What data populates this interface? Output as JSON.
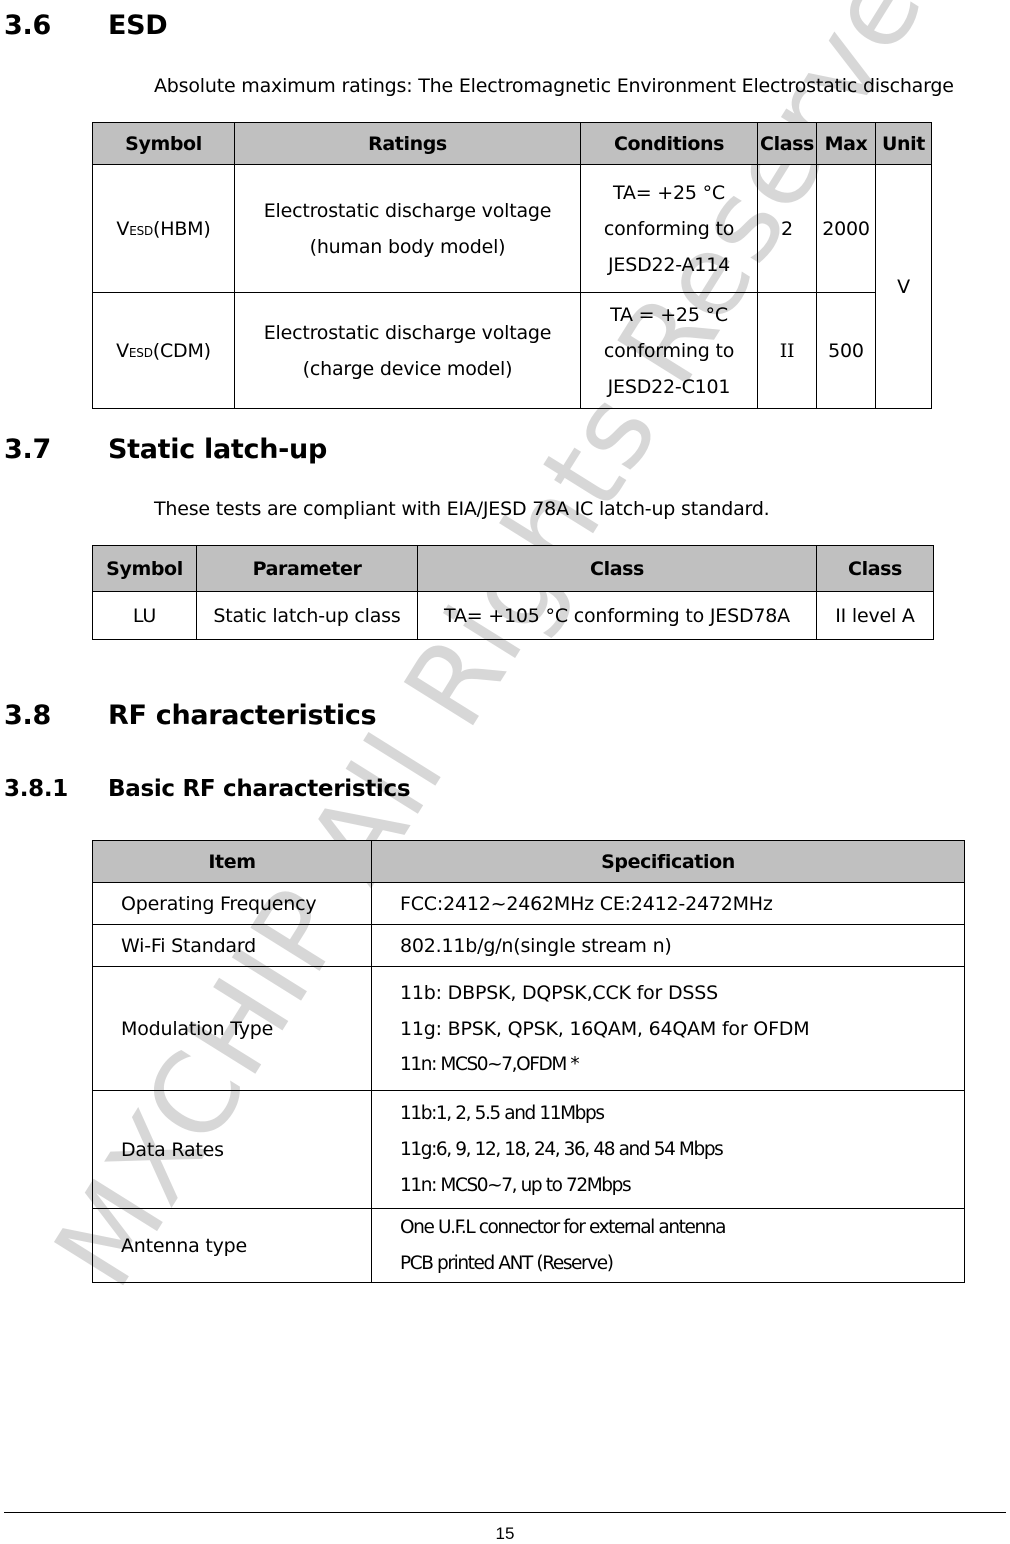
{
  "sections": {
    "esd": {
      "number": "3.6",
      "title": "ESD",
      "intro": "Absolute maximum ratings: The Electromagnetic Environment Electrostatic discharge",
      "table": {
        "headers": [
          "Symbol",
          "Ratings",
          "Conditions",
          "Class",
          "Max",
          "Unit"
        ],
        "rows": [
          {
            "symbol_main": "V",
            "symbol_sub": "ESD",
            "symbol_suffix": "(HBM)",
            "ratings_line1": "Electrostatic discharge voltage",
            "ratings_line2": "(human body model)",
            "cond_line1": "TA= +25 °C",
            "cond_line2": "conforming to",
            "cond_line3": "JESD22-A114",
            "class": "2",
            "max": "2000"
          },
          {
            "symbol_main": "V",
            "symbol_sub": "ESD",
            "symbol_suffix": "(CDM)",
            "ratings_line1": "Electrostatic discharge voltage",
            "ratings_line2": "(charge device model)",
            "cond_line1": "TA = +25 °C",
            "cond_line2": "conforming to",
            "cond_line3": "JESD22-C101",
            "class": "II",
            "max": "500"
          }
        ],
        "unit": "V"
      }
    },
    "latchup": {
      "number": "3.7",
      "title": "Static latch-up",
      "intro": "These tests are compliant with EIA/JESD 78A IC latch-up standard.",
      "table": {
        "headers": [
          "Symbol",
          "Parameter",
          "Class",
          "Class"
        ],
        "rows": [
          [
            "LU",
            "Static latch-up class",
            "TA= +105 °C conforming to JESD78A",
            "II level A"
          ]
        ]
      }
    },
    "rf": {
      "number": "3.8",
      "title": "RF characteristics",
      "sub_number": "3.8.1",
      "sub_title": "Basic RF characteristics",
      "table": {
        "headers": [
          "Item",
          "Specification"
        ],
        "rows": [
          {
            "item": "Operating Frequency",
            "spec": [
              "FCC:2412~2462MHz CE:2412-2472MHz"
            ]
          },
          {
            "item": "Wi-Fi Standard",
            "spec": [
              "802.11b/g/n(single stream n)"
            ]
          },
          {
            "item": "Modulation Type",
            "spec": [
              "11b: DBPSK, DQPSK,CCK for DSSS",
              "11g: BPSK, QPSK, 16QAM, 64QAM for OFDM",
              "11n: MCS0~7,OFDM *"
            ]
          },
          {
            "item": "Data Rates",
            "spec": [
              "11b:1, 2, 5.5 and 11Mbps",
              "11g:6, 9, 12, 18, 24, 36, 48 and 54 Mbps",
              "11n: MCS0~7, up to 72Mbps"
            ]
          },
          {
            "item": "Antenna type",
            "spec": [
              "One U.F.L connector for external antenna",
              "PCB printed ANT (Reserve)"
            ]
          }
        ]
      }
    }
  },
  "watermark": "MXCHIP All Rights Reserved",
  "footer": {
    "page_number": "15"
  }
}
